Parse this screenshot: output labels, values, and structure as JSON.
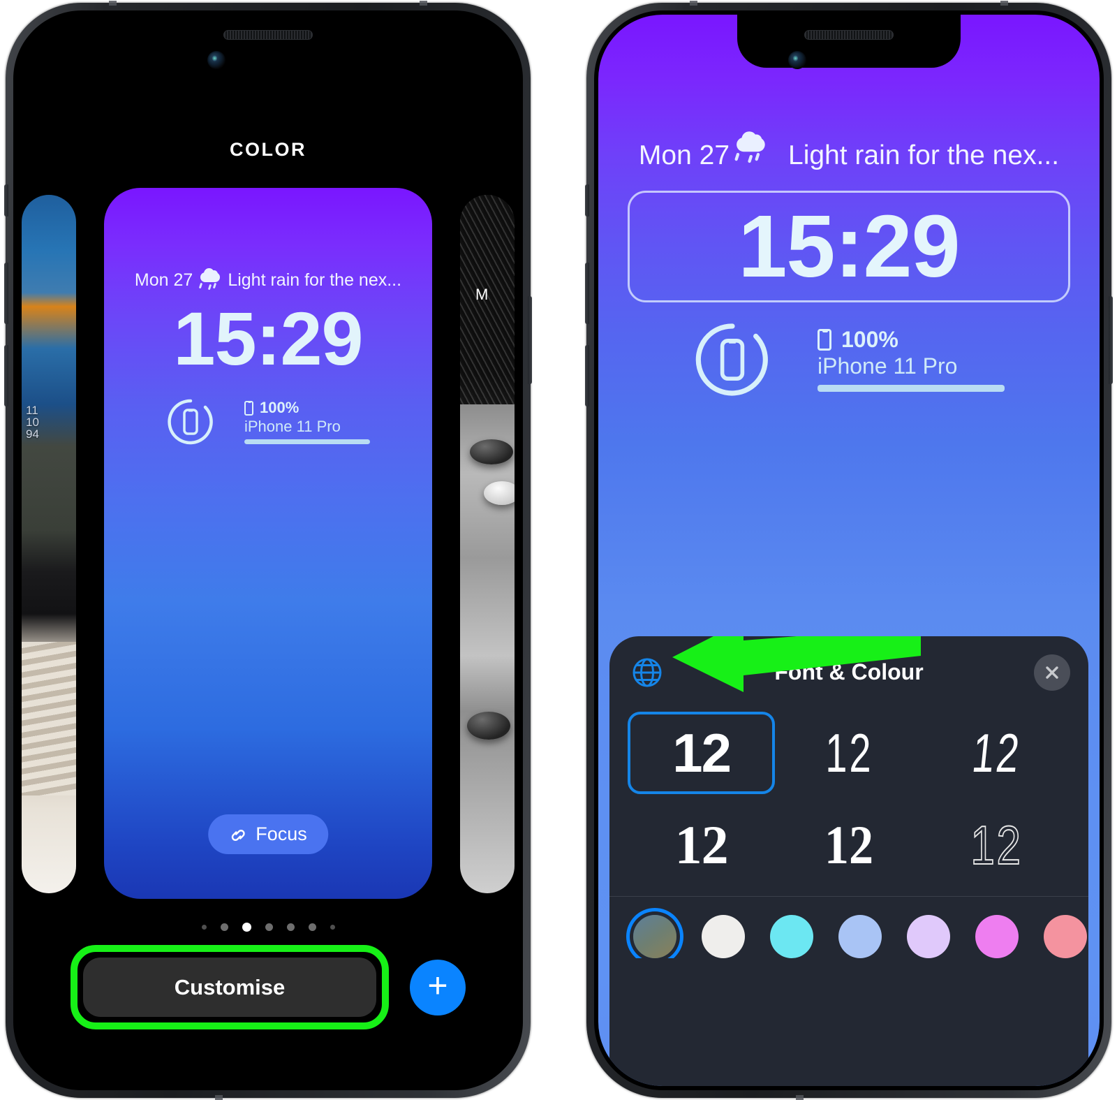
{
  "left_phone": {
    "gallery_title": "COLOR",
    "lock_preview": {
      "date": "Mon 27",
      "weather_icon": "rain-cloud-icon",
      "weather_text": "Light rain for the nex...",
      "time": "15:29",
      "battery_percent": "100%",
      "device_name": "iPhone 11 Pro",
      "focus_label": "Focus",
      "focus_icon": "link-icon"
    },
    "side_previews": {
      "left_partial_text": "11\n10\n94",
      "right_partial_text": "M"
    },
    "page_dots": {
      "count": 7,
      "active_index": 2
    },
    "customise_button": "Customise",
    "add_button": "+",
    "highlight_color": "#17f017"
  },
  "right_phone": {
    "lock_screen": {
      "date": "Mon 27",
      "weather_icon": "rain-cloud-icon",
      "weather_text": "Light rain for the nex...",
      "time": "15:29",
      "battery_percent": "100%",
      "device_name": "iPhone 11 Pro"
    },
    "sheet": {
      "title": "Font & Colour",
      "globe_icon": "globe-icon",
      "close_icon": "close-icon",
      "fonts": [
        {
          "label": "12",
          "style": "bold",
          "selected": true
        },
        {
          "label": "12",
          "style": "light",
          "selected": false
        },
        {
          "label": "12",
          "style": "slant",
          "selected": false
        },
        {
          "label": "12",
          "style": "serif",
          "selected": false
        },
        {
          "label": "12",
          "style": "slab",
          "selected": false
        },
        {
          "label": "12",
          "style": "outline",
          "selected": false
        }
      ],
      "colors": [
        {
          "name": "multicolour",
          "hex": "#6f7a68",
          "selected": true
        },
        {
          "name": "white",
          "hex": "#efeeec",
          "selected": false
        },
        {
          "name": "cyan",
          "hex": "#6ce7f2",
          "selected": false
        },
        {
          "name": "light-blue",
          "hex": "#a9c4f5",
          "selected": false
        },
        {
          "name": "lavender",
          "hex": "#e0c9fb",
          "selected": false
        },
        {
          "name": "magenta",
          "hex": "#ee7ef0",
          "selected": false
        },
        {
          "name": "pink",
          "hex": "#f4939f",
          "selected": false
        }
      ],
      "selection_color": "#0a84ff"
    },
    "annotation": {
      "arrow_color": "#17f017",
      "points_to": "globe-icon"
    }
  }
}
